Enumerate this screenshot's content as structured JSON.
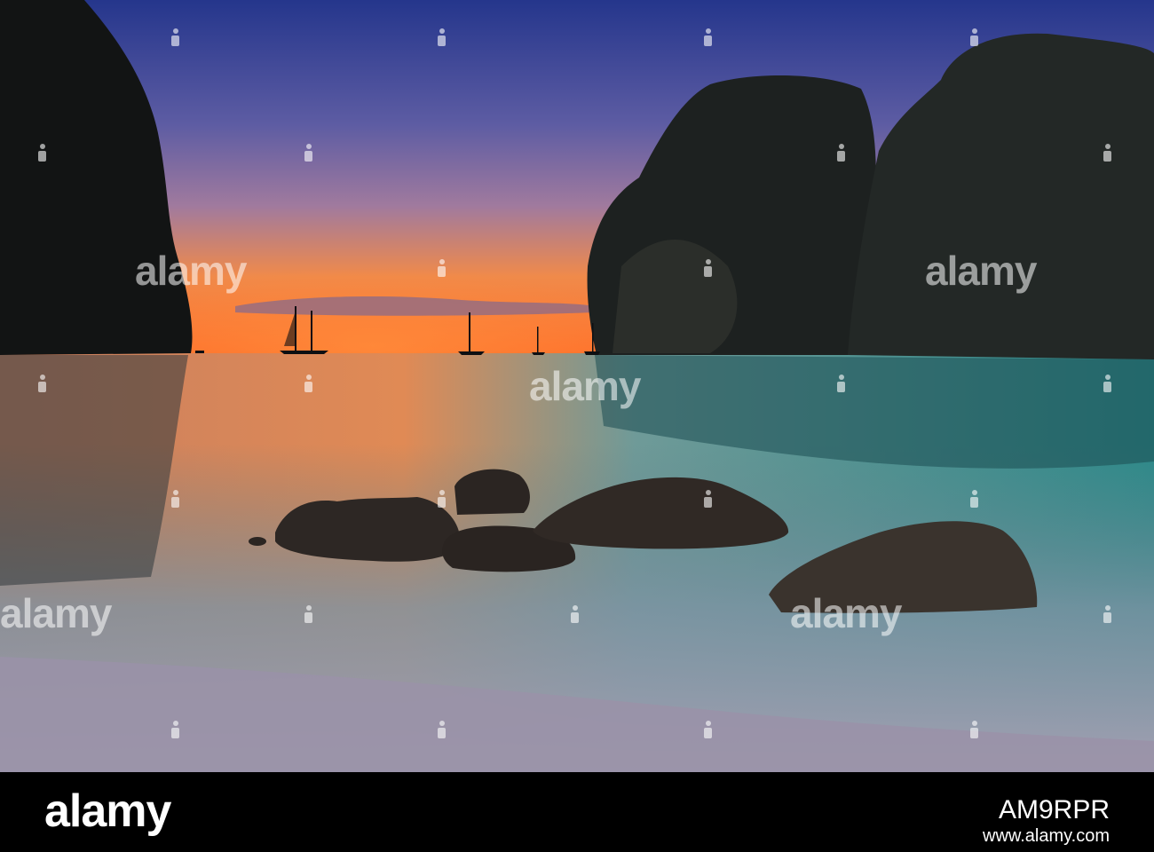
{
  "scene": {
    "description_colors": {
      "sky_top": "#2b3a8f",
      "sky_mid": "#7d6aa8",
      "horizon_glow": "#ff7a2a",
      "water_left": "#d98a5a",
      "water_right": "#2f8c8c",
      "water_near": "#8fa0b0",
      "cliff": "#1a1c1c",
      "rock": "#2c2623"
    },
    "boats_count_shown": 5
  },
  "watermark": {
    "text": "alamy"
  },
  "footer": {
    "logo": "alamy",
    "image_id": "AM9RPR",
    "site": "www.alamy.com"
  }
}
